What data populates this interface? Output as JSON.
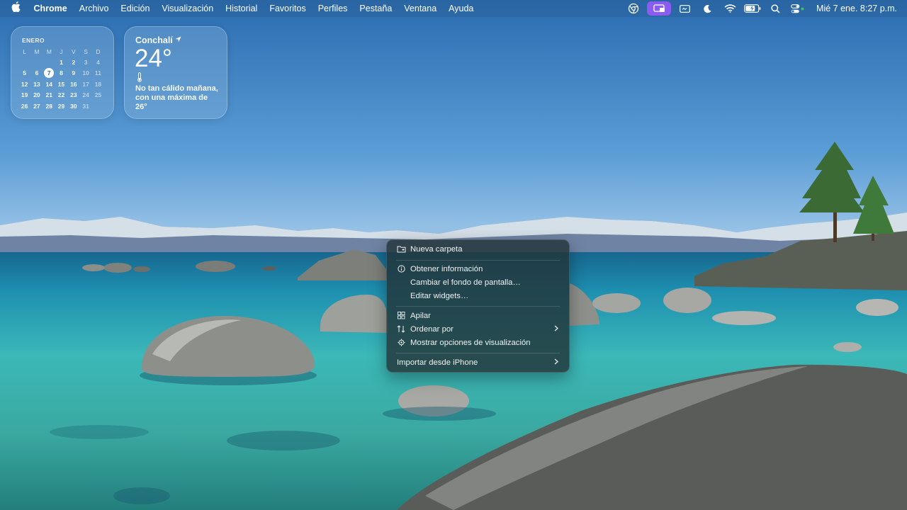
{
  "menubar": {
    "apple_icon": "apple-logo",
    "app_name": "Chrome",
    "menus": [
      "Archivo",
      "Edición",
      "Visualización",
      "Historial",
      "Favoritos",
      "Perfiles",
      "Pestaña",
      "Ventana",
      "Ayuda"
    ],
    "status_icons": [
      "chrome-profile-icon",
      "screen-mirroring-icon",
      "display-icon",
      "focus-moon-icon",
      "wifi-icon",
      "battery-icon",
      "spotlight-search-icon",
      "control-center-icon"
    ],
    "clock": "Mié 7 ene.  8:27 p.m.",
    "active_icon_color": "#8c5bf0"
  },
  "calendar_widget": {
    "month": "ENERO",
    "weekdays": [
      "L",
      "M",
      "M",
      "J",
      "V",
      "S",
      "D"
    ],
    "weeks": [
      [
        "",
        "",
        "",
        "1",
        "2",
        "3",
        "4"
      ],
      [
        "5",
        "6",
        "7",
        "8",
        "9",
        "10",
        "11"
      ],
      [
        "12",
        "13",
        "14",
        "15",
        "16",
        "17",
        "18"
      ],
      [
        "19",
        "20",
        "21",
        "22",
        "23",
        "24",
        "25"
      ],
      [
        "26",
        "27",
        "28",
        "29",
        "30",
        "31",
        ""
      ]
    ],
    "today": "7"
  },
  "weather_widget": {
    "location": "Conchalí",
    "temperature": "24°",
    "description": "No tan cálido mañana, con una máxima de 26°"
  },
  "context_menu": {
    "items": [
      {
        "label": "Nueva carpeta",
        "icon": "new-folder-icon"
      },
      {
        "label": "Obtener información",
        "icon": "info-icon"
      },
      {
        "label": "Cambiar el fondo de pantalla…",
        "icon": ""
      },
      {
        "label": "Editar widgets…",
        "icon": ""
      },
      {
        "label": "Apilar",
        "icon": "stack-icon"
      },
      {
        "label": "Ordenar por",
        "icon": "sort-icon",
        "submenu": true
      },
      {
        "label": "Mostrar opciones de visualización",
        "icon": "view-options-icon"
      },
      {
        "label": "Importar desde iPhone",
        "icon": "",
        "submenu": true
      }
    ]
  }
}
